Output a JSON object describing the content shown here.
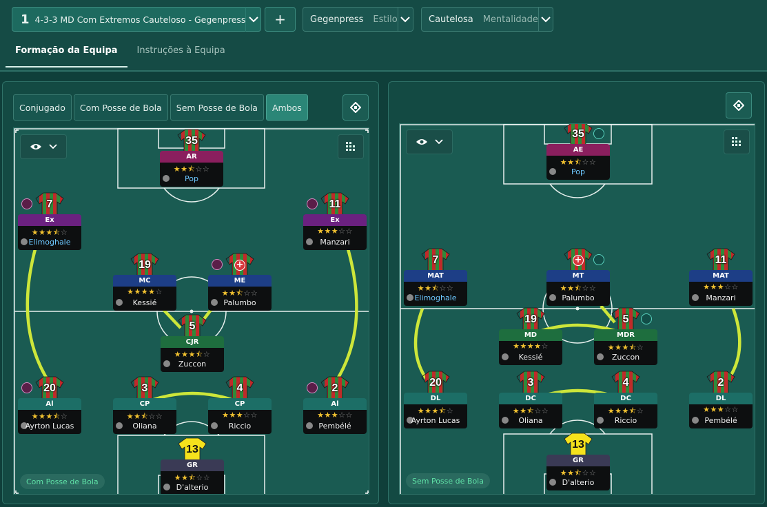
{
  "topbar": {
    "tactic_number": "1",
    "tactic_name": "4-3-3 MD Com Extremos Cauteloso - Gegenpress",
    "add_label": "+",
    "style": {
      "value": "Gegenpress",
      "label": "Estilo"
    },
    "mentality": {
      "value": "Cautelosa",
      "label": "Mentalidade"
    }
  },
  "tabs": [
    {
      "label": "Formação da Equipa",
      "active": true
    },
    {
      "label": "Instruções à Equipa",
      "active": false
    }
  ],
  "left": {
    "phase_buttons": [
      "Conjugado",
      "Com Posse de Bola",
      "Sem Posse de Bola",
      "Ambos"
    ],
    "active_phase": "Ambos",
    "phase_badge": "Com Posse de Bola",
    "players": [
      {
        "num": "35",
        "role": "AR",
        "role_color": "#8a1f5e",
        "stars": 2.5,
        "name": "Pop",
        "name_color": "blue"
      },
      {
        "num": "7",
        "role": "Ex",
        "role_color": "#6b2180",
        "stars": 3.5,
        "name": "Elimoghale",
        "name_color": "blue",
        "badge": "pink"
      },
      {
        "num": "11",
        "role": "Ex",
        "role_color": "#6b2180",
        "stars": 3,
        "name": "Manzari",
        "name_color": "white",
        "badge": "pink"
      },
      {
        "num": "19",
        "role": "MC",
        "role_color": "#1d3e86",
        "stars": 4,
        "name": "Kessié",
        "name_color": "white"
      },
      {
        "num": "",
        "role": "ME",
        "role_color": "#1d3e86",
        "stars": 2.5,
        "name": "Palumbo",
        "name_color": "white",
        "badge": "pink",
        "injured": true
      },
      {
        "num": "5",
        "role": "CJR",
        "role_color": "#1e6e3e",
        "stars": 3.5,
        "name": "Zuccon",
        "name_color": "white"
      },
      {
        "num": "20",
        "role": "Al",
        "role_color": "#1c6e66",
        "stars": 3.5,
        "name": "Ayrton Lucas",
        "name_color": "white",
        "badge": "pink"
      },
      {
        "num": "3",
        "role": "CP",
        "role_color": "#1c6e66",
        "stars": 2.5,
        "name": "Oliana",
        "name_color": "white"
      },
      {
        "num": "4",
        "role": "CP",
        "role_color": "#1c6e66",
        "stars": 3,
        "name": "Riccio",
        "name_color": "white"
      },
      {
        "num": "2",
        "role": "Al",
        "role_color": "#1c6e66",
        "stars": 3,
        "name": "Pembélé",
        "name_color": "white",
        "badge": "pink"
      },
      {
        "num": "13",
        "role": "GR",
        "role_color": "#3a3a55",
        "stars": 2.5,
        "name": "D'alterio",
        "name_color": "white",
        "gk": true
      }
    ]
  },
  "right": {
    "phase_badge": "Sem Posse de Bola",
    "players": [
      {
        "num": "35",
        "role": "AE",
        "role_color": "#8a1f5e",
        "stars": 2.5,
        "name": "Pop",
        "name_color": "blue",
        "badge": "teal"
      },
      {
        "num": "7",
        "role": "MAT",
        "role_color": "#1d3e86",
        "stars": 2.5,
        "name": "Elimoghale",
        "name_color": "blue"
      },
      {
        "num": "",
        "role": "MT",
        "role_color": "#1d3e86",
        "stars": 2.5,
        "name": "Palumbo",
        "name_color": "white",
        "badge": "teal",
        "injured": true
      },
      {
        "num": "11",
        "role": "MAT",
        "role_color": "#1d3e86",
        "stars": 3,
        "name": "Manzari",
        "name_color": "white"
      },
      {
        "num": "19",
        "role": "MD",
        "role_color": "#1e6e3e",
        "stars": 4,
        "name": "Kessié",
        "name_color": "white"
      },
      {
        "num": "5",
        "role": "MDR",
        "role_color": "#1e6e3e",
        "stars": 3.5,
        "name": "Zuccon",
        "name_color": "white",
        "badge": "teal"
      },
      {
        "num": "20",
        "role": "DL",
        "role_color": "#1c6e66",
        "stars": 3.5,
        "name": "Ayrton Lucas",
        "name_color": "white"
      },
      {
        "num": "3",
        "role": "DC",
        "role_color": "#1c6e66",
        "stars": 2.5,
        "name": "Oliana",
        "name_color": "white"
      },
      {
        "num": "4",
        "role": "DC",
        "role_color": "#1c6e66",
        "stars": 3.5,
        "name": "Riccio",
        "name_color": "white"
      },
      {
        "num": "2",
        "role": "DL",
        "role_color": "#1c6e66",
        "stars": 3,
        "name": "Pembélé",
        "name_color": "white"
      },
      {
        "num": "13",
        "role": "GR",
        "role_color": "#3a3a55",
        "stars": 2.5,
        "name": "D'alterio",
        "name_color": "white",
        "gk": true
      }
    ]
  },
  "icons": {
    "chevron": "chevron-down-icon",
    "eye": "eye-icon",
    "grid": "grid-icon",
    "pitch_view": "pitch-toggle-icon"
  }
}
